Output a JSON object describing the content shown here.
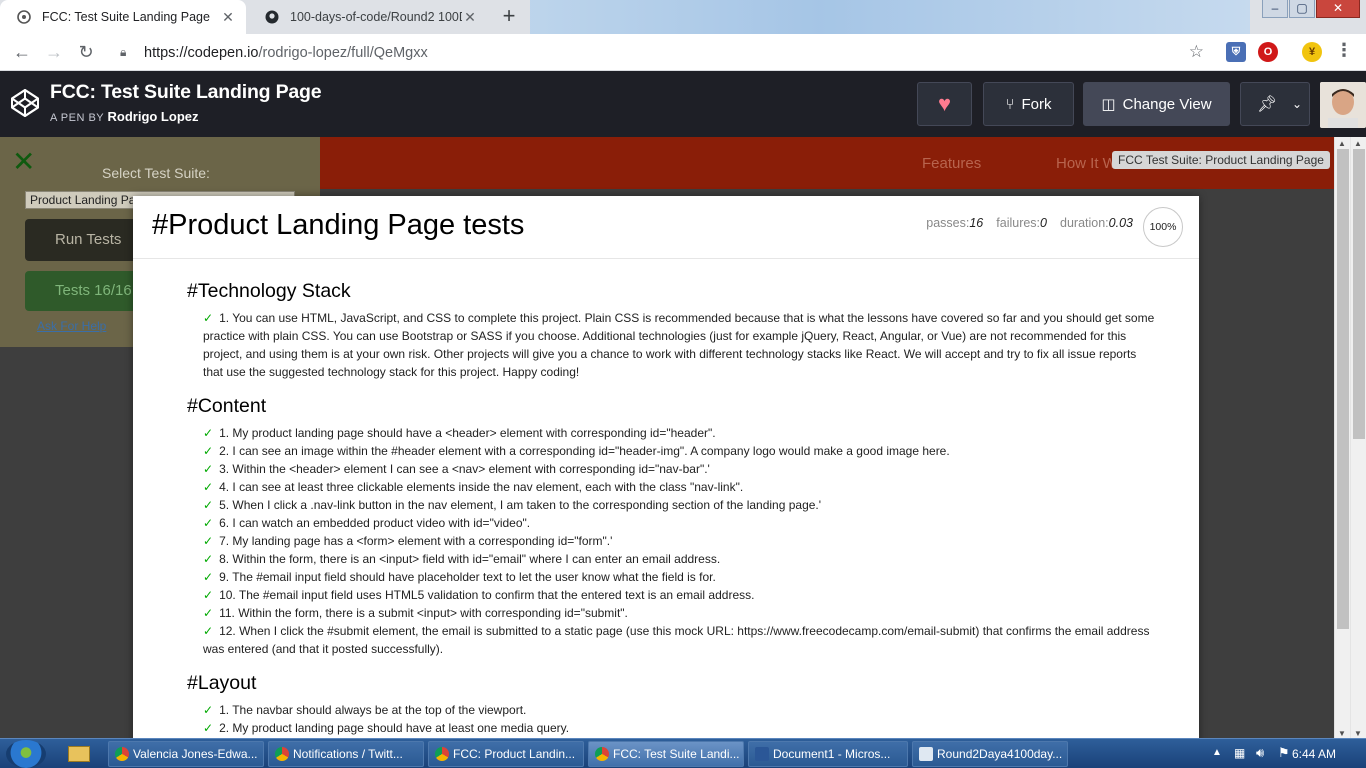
{
  "browser": {
    "tabs": [
      {
        "title": "FCC: Test Suite Landing Page",
        "active": true
      },
      {
        "title": "100-days-of-code/Round2 100D",
        "active": false
      }
    ],
    "url_host": "https://codepen.io",
    "url_path": "/rodrigo-lopez/full/QeMgxx"
  },
  "codepen": {
    "pen_title": "FCC: Test Suite Landing Page",
    "by_label": "A PEN BY",
    "author": "Rodrigo Lopez",
    "fork_label": "Fork",
    "change_view_label": "Change View"
  },
  "underlay": {
    "nav_features": "Features",
    "nav_how": "How It W",
    "select_label": "Select Test Suite:",
    "select_value": "Product Landing Pa",
    "run_label": "Run Tests",
    "passed_label": "Tests 16/16",
    "help_label": "Ask For Help",
    "suite_tooltip": "FCC Test Suite: Product Landing Page"
  },
  "report": {
    "title": "#Product Landing Page tests",
    "passes_label": "passes:",
    "passes": "16",
    "failures_label": "failures:",
    "failures": "0",
    "duration_label": "duration:",
    "duration": "0.03",
    "progress": "100%",
    "suites": [
      {
        "name": "#Technology Stack",
        "tests": [
          "1. You can use HTML, JavaScript, and CSS to complete this project. Plain CSS is recommended because that is what the lessons have covered so far and you should get some practice with plain CSS. You can use Bootstrap or SASS if you choose. Additional technologies (just for example jQuery, React, Angular, or Vue) are not recommended for this project, and using them is at your own risk. Other projects will give you a chance to work with different technology stacks like React. We will accept and try to fix all issue reports that use the suggested technology stack for this project. Happy coding!"
        ]
      },
      {
        "name": "#Content",
        "tests": [
          "1. My product landing page should have a <header> element with corresponding id=\"header\".",
          "2. I can see an image within the #header element with a corresponding id=\"header-img\". A company logo would make a good image here.",
          "3. Within the <header> element I can see a <nav> element with corresponding id=\"nav-bar\".'",
          "4. I can see at least three clickable elements inside the nav element, each with the class \"nav-link\".",
          "5. When I click a .nav-link button in the nav element, I am taken to the corresponding section of the landing page.'",
          "6. I can watch an embedded product video with id=\"video\".",
          "7. My landing page has a <form> element with a corresponding id=\"form\".'",
          "8. Within the form, there is an <input> field with id=\"email\" where I can enter an email address.",
          "9. The #email input field should have placeholder text to let the user know what the field is for.",
          "10. The #email input field uses HTML5 validation to confirm that the entered text is an email address.",
          "11. Within the form, there is a submit <input> with corresponding id=\"submit\".",
          "12. When I click the #submit element, the email is submitted to a static page (use this mock URL: https://www.freecodecamp.com/email-submit) that confirms the email address was entered (and that it posted successfully)."
        ]
      },
      {
        "name": "#Layout",
        "tests": [
          "1. The navbar should always be at the top of the viewport.",
          "2. My product landing page should have at least one media query."
        ]
      }
    ],
    "check_glyph": "✓"
  },
  "taskbar": {
    "items": [
      "Valencia Jones-Edwa...",
      "Notifications / Twitt...",
      "FCC: Product Landin...",
      "FCC: Test Suite Landi...",
      "Document1 - Micros...",
      "Round2Daya4100day..."
    ],
    "clock": "6:44 AM"
  },
  "colors": {
    "codepen_header": "#1e1f26",
    "pass_green": "#00a900",
    "taskbar": "#1d4f8c"
  }
}
